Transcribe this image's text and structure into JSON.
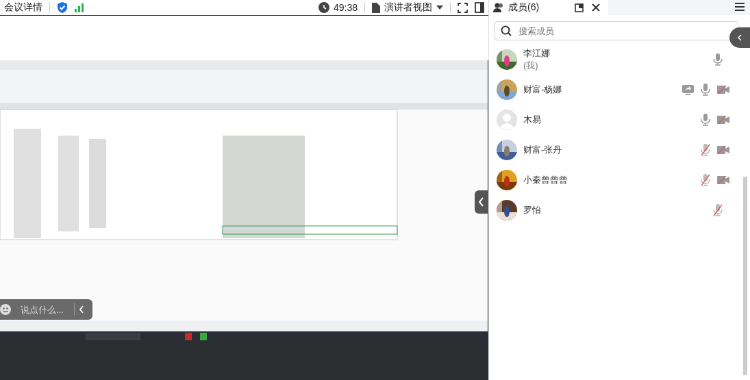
{
  "top_bar": {
    "title": "会议详情",
    "timer": "49:38",
    "view_mode": "演讲者视图"
  },
  "chat_input": {
    "placeholder": "说点什么..."
  },
  "panel": {
    "tab": "成员(6)",
    "search": {
      "placeholder": "搜索成员"
    },
    "members": [
      {
        "name": "李江娜",
        "note": "(我)",
        "screen_share": false,
        "mic_muted": false
      },
      {
        "name": "财富-杨娜",
        "screen_share": true,
        "mic_muted": false,
        "camera_off": true
      },
      {
        "name": "木易",
        "kind": "default",
        "screen_share": false,
        "mic_muted": false,
        "camera_off": true
      },
      {
        "name": "财富-张丹",
        "screen_share": false,
        "mic_muted": true,
        "camera_off": true
      },
      {
        "name": "小秦曾曾曾",
        "screen_share": false,
        "mic_muted": true,
        "camera_off": true
      },
      {
        "name": "罗怡",
        "screen_share": false,
        "mic_muted": true
      }
    ]
  }
}
